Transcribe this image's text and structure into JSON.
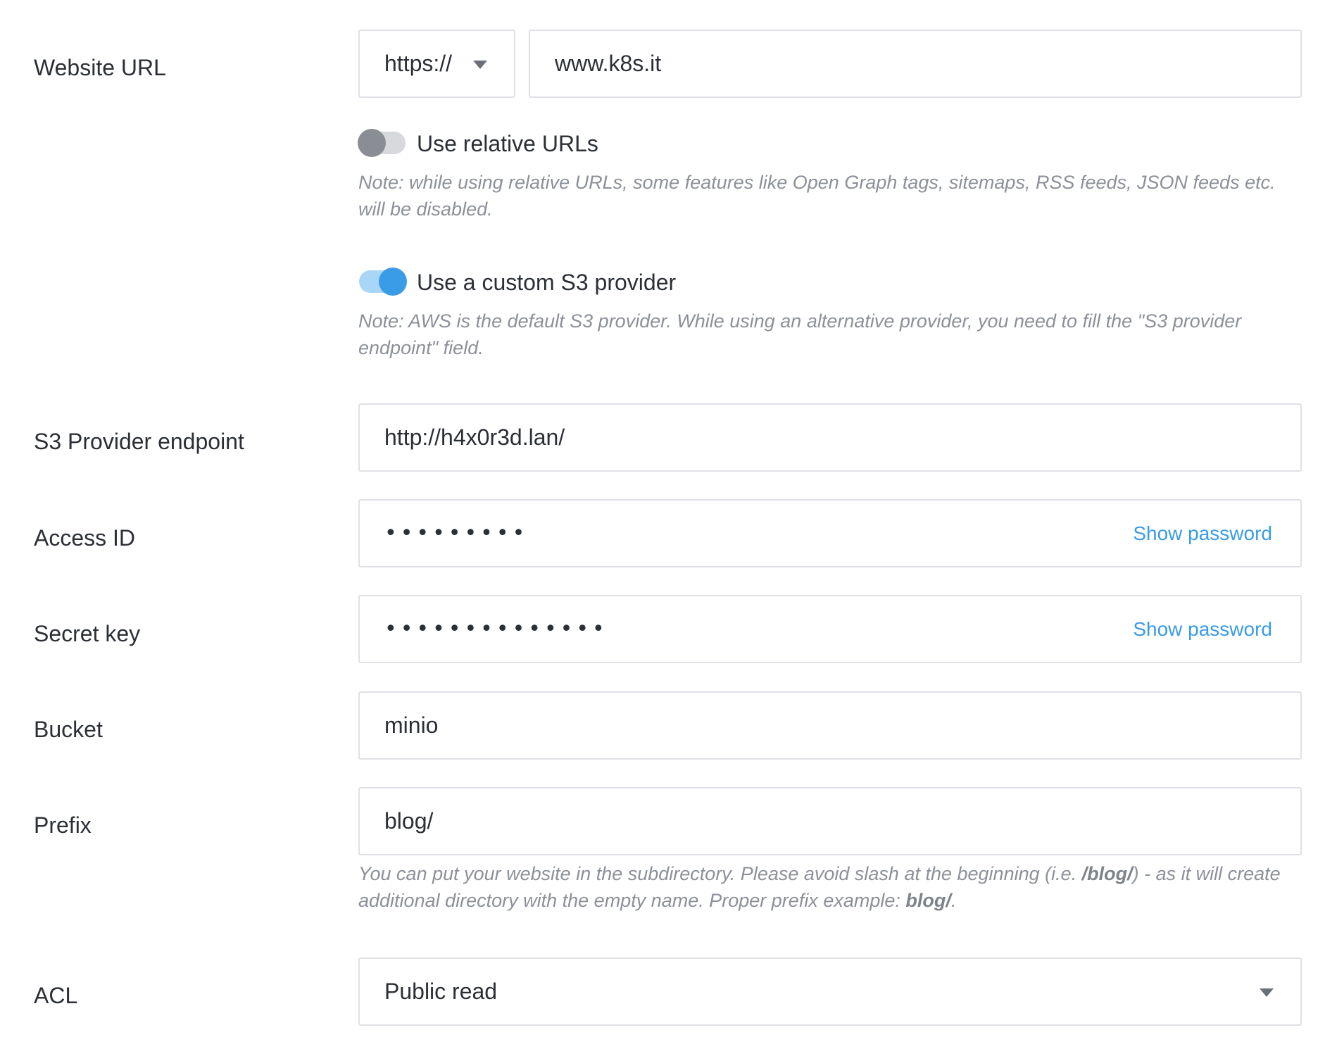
{
  "website_url": {
    "label": "Website URL",
    "protocol": "https://",
    "value": "www.k8s.it"
  },
  "relative_urls": {
    "label": "Use relative URLs",
    "enabled": false,
    "note": "Note: while using relative URLs, some features like Open Graph tags, sitemaps, RSS feeds, JSON feeds etc. will be disabled."
  },
  "custom_s3": {
    "label": "Use a custom S3 provider",
    "enabled": true,
    "note": "Note: AWS is the default S3 provider. While using an alternative provider, you need to fill the \"S3 provider endpoint\" field."
  },
  "endpoint": {
    "label": "S3 Provider endpoint",
    "value": "http://h4x0r3d.lan/"
  },
  "access_id": {
    "label": "Access ID",
    "masked": "•••••••••",
    "show_label": "Show password"
  },
  "secret_key": {
    "label": "Secret key",
    "masked": "••••••••••••••",
    "show_label": "Show password"
  },
  "bucket": {
    "label": "Bucket",
    "value": "minio"
  },
  "prefix": {
    "label": "Prefix",
    "value": "blog/",
    "note_part1": "You can put your website in the subdirectory. Please avoid slash at the beginning (i.e. ",
    "note_bold1": "/blog/",
    "note_part2": ") - as it will create additional directory with the empty name. Proper prefix example: ",
    "note_bold2": "blog/",
    "note_part3": "."
  },
  "acl": {
    "label": "ACL",
    "value": "Public read"
  },
  "colors": {
    "accent": "#3a9be6",
    "toggle_off": "#8b8d94",
    "border": "#dfe1e6",
    "note_text": "#8c9099"
  }
}
